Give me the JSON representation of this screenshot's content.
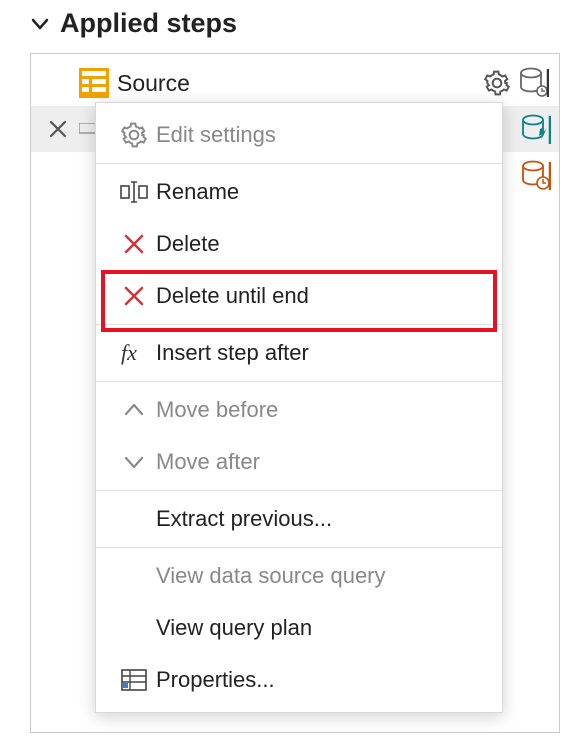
{
  "header": {
    "title": "Applied steps"
  },
  "steps": {
    "source": "Source"
  },
  "menu": {
    "edit_settings": "Edit settings",
    "rename": "Rename",
    "delete": "Delete",
    "delete_until_end": "Delete until end",
    "insert_step_after": "Insert step after",
    "move_before": "Move before",
    "move_after": "Move after",
    "extract_previous": "Extract previous...",
    "view_data_source_query": "View data source query",
    "view_query_plan": "View query plan",
    "properties": "Properties..."
  }
}
